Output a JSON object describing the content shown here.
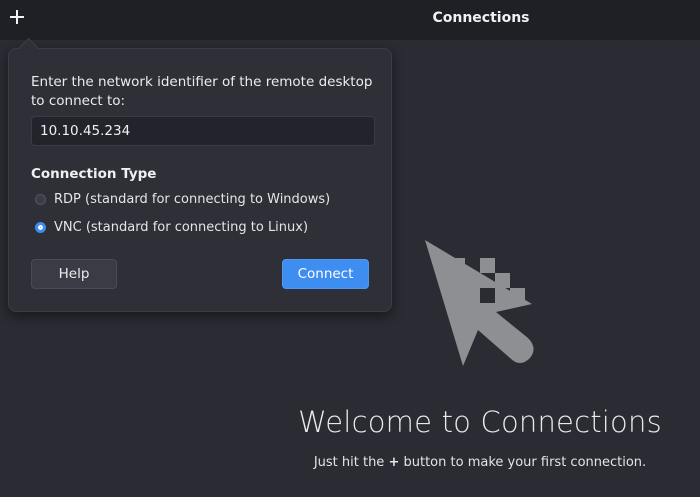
{
  "header": {
    "title": "Connections",
    "add_icon": "plus-icon"
  },
  "popover": {
    "prompt": "Enter the network identifier of the remote desktop to connect to:",
    "address_value": "10.10.45.234",
    "connection_type_title": "Connection Type",
    "options": [
      {
        "label": "RDP (standard for connecting to Windows)",
        "selected": false
      },
      {
        "label": "VNC (standard for connecting to Linux)",
        "selected": true
      }
    ],
    "help_label": "Help",
    "connect_label": "Connect"
  },
  "welcome": {
    "title": "Welcome to Connections",
    "subtitle_before": "Just hit the",
    "subtitle_symbol": "+",
    "subtitle_after": "button to make your first connection.",
    "illustration_icon": "cursor-pixel-icon"
  },
  "colors": {
    "background": "#2a2b33",
    "headerbar": "#1f2026",
    "accent": "#3d8ef0",
    "illustration": "#8e8f93"
  }
}
